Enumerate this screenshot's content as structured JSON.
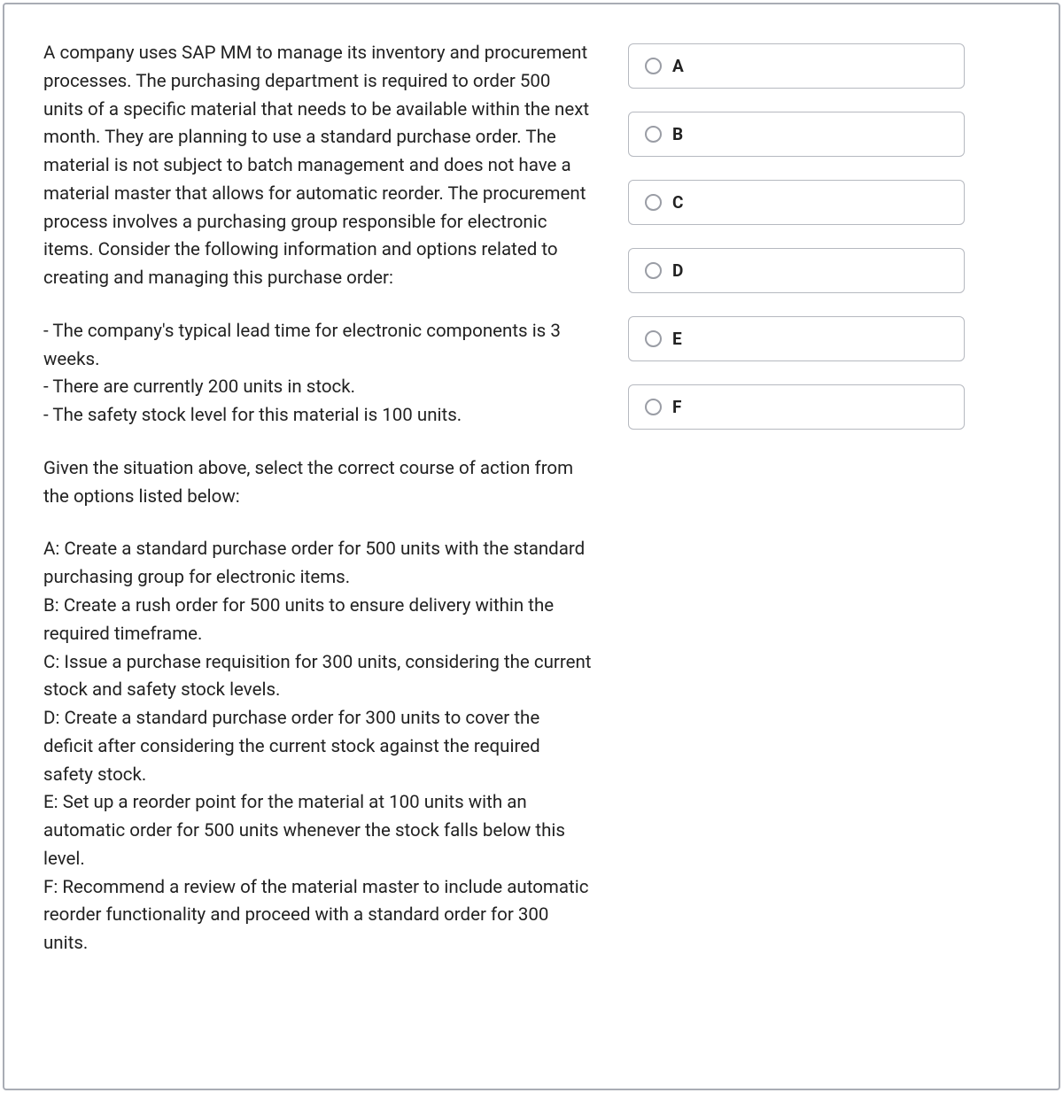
{
  "question": {
    "intro": "A company uses SAP MM to manage its inventory and procurement processes. The purchasing department is required to order 500 units of a specific material that needs to be available within the next month. They are planning to use a standard purchase order. The material is not subject to batch management and does not have a material master that allows for automatic reorder. The procurement process involves a purchasing group responsible for electronic items. Consider the following information and options related to creating and managing this purchase order:",
    "bullets": [
      "- The company's typical lead time for electronic components is 3 weeks.",
      "- There are currently 200 units in stock.",
      "- The safety stock level for this material is 100 units."
    ],
    "prompt": "Given the situation above, select the correct course of action from the options listed below:",
    "options_text": [
      "A: Create a standard purchase order for 500 units with the standard purchasing group for electronic items.",
      "B: Create a rush order for 500 units to ensure delivery within the required timeframe.",
      "C: Issue a purchase requisition for 300 units, considering the current stock and safety stock levels.",
      "D: Create a standard purchase order for 300 units to cover the deficit after considering the current stock against the required safety stock.",
      "E: Set up a reorder point for the material at 100 units with an automatic order for 500 units whenever the stock falls below this level.",
      "F: Recommend a review of the material master to include automatic reorder functionality and proceed with a standard order for 300 units."
    ]
  },
  "choices": [
    {
      "label": "A"
    },
    {
      "label": "B"
    },
    {
      "label": "C"
    },
    {
      "label": "D"
    },
    {
      "label": "E"
    },
    {
      "label": "F"
    }
  ]
}
